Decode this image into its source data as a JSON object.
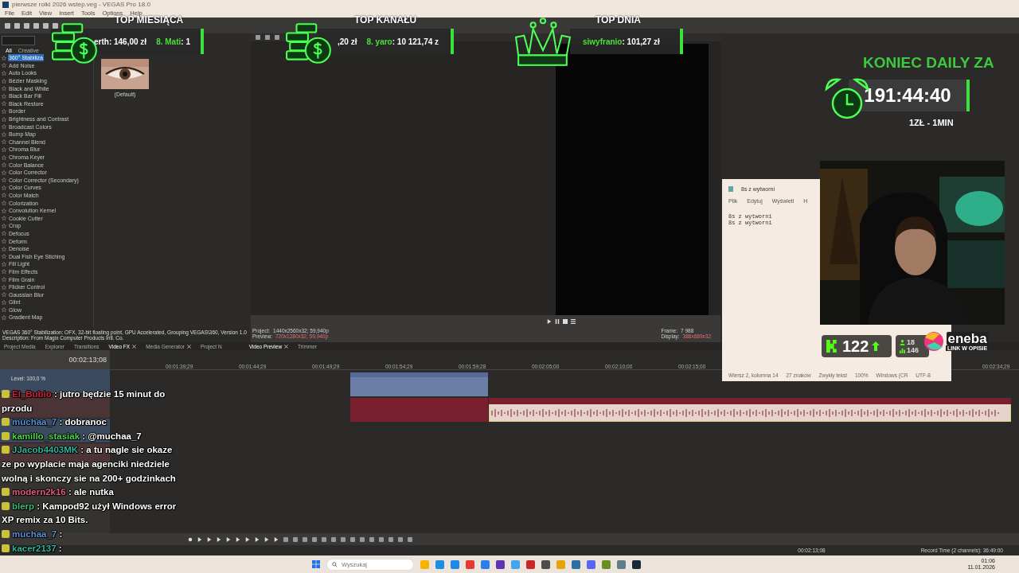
{
  "app": {
    "title": "pierwsze rolki 2026 wstep.veg - VEGAS Pro 18.0",
    "menu": [
      "File",
      "Edit",
      "View",
      "Insert",
      "Tools",
      "Options",
      "Help"
    ]
  },
  "fx_panel": {
    "filters": [
      {
        "label": "All",
        "selected": true
      },
      {
        "label": "Creative",
        "selected": false
      }
    ],
    "items": [
      {
        "label": "360° Stabiliza",
        "selected": true
      },
      {
        "label": "Add Noise",
        "selected": false
      },
      {
        "label": "Auto Looks",
        "selected": false
      },
      {
        "label": "Bézier Masking",
        "selected": false
      },
      {
        "label": "Black and White",
        "selected": false
      },
      {
        "label": "Black Bar Fill",
        "selected": false
      },
      {
        "label": "Black Restore",
        "selected": false
      },
      {
        "label": "Border",
        "selected": false
      },
      {
        "label": "Brightness and Contrast",
        "selected": false
      },
      {
        "label": "Broadcast Colors",
        "selected": false
      },
      {
        "label": "Bump Map",
        "selected": false
      },
      {
        "label": "Channel Blend",
        "selected": false
      },
      {
        "label": "Chroma Blur",
        "selected": false
      },
      {
        "label": "Chroma Keyer",
        "selected": false
      },
      {
        "label": "Color Balance",
        "selected": false
      },
      {
        "label": "Color Corrector",
        "selected": false
      },
      {
        "label": "Color Corrector (Secondary)",
        "selected": false
      },
      {
        "label": "Color Curves",
        "selected": false
      },
      {
        "label": "Color Match",
        "selected": false
      },
      {
        "label": "Colorization",
        "selected": false
      },
      {
        "label": "Convolution Kernel",
        "selected": false
      },
      {
        "label": "Cookie Cutter",
        "selected": false
      },
      {
        "label": "Crop",
        "selected": false
      },
      {
        "label": "Defocus",
        "selected": false
      },
      {
        "label": "Deform",
        "selected": false
      },
      {
        "label": "Denoise",
        "selected": false
      },
      {
        "label": "Dual Fish Eye Stiching",
        "selected": false
      },
      {
        "label": "Fill Light",
        "selected": false
      },
      {
        "label": "Film Effects",
        "selected": false
      },
      {
        "label": "Film Grain",
        "selected": false
      },
      {
        "label": "Flicker Control",
        "selected": false
      },
      {
        "label": "Gaussian Blur",
        "selected": false
      },
      {
        "label": "Glint",
        "selected": false
      },
      {
        "label": "Glow",
        "selected": false
      },
      {
        "label": "Gradient Map",
        "selected": false
      }
    ]
  },
  "presets": [
    {
      "label": "(Default)"
    }
  ],
  "description": [
    "VEGAS 360° Stabilization: OFX, 32-bit floating point, GPU Accelerated, Grouping VEGAS\\360, Version 1.0",
    "Description: From Magix Computer Products Intl. Co."
  ],
  "preview": {
    "info_left": [
      {
        "label": "Project:",
        "value": "1440x2560x32; 59,940p"
      },
      {
        "label": "Preview:",
        "value": "720x1280x32; 59,940p"
      }
    ],
    "info_right": [
      {
        "label": "Frame:",
        "value": "7 988"
      },
      {
        "label": "Display:",
        "value": "388x689x32"
      }
    ]
  },
  "dock_tabs": [
    {
      "label": "Project Media",
      "selected": false,
      "closable": false
    },
    {
      "label": "Explorer",
      "selected": false,
      "closable": false
    },
    {
      "label": "Transitions",
      "selected": false,
      "closable": false
    },
    {
      "label": "Video FX",
      "selected": true,
      "closable": true
    },
    {
      "label": "Media Generator",
      "selected": false,
      "closable": true
    },
    {
      "label": "Project N",
      "selected": false,
      "closable": false
    }
  ],
  "preview_tabs": [
    {
      "label": "Video Preview",
      "selected": true,
      "closable": true
    },
    {
      "label": "Trimmer",
      "selected": false,
      "closable": false
    }
  ],
  "timeline": {
    "time": "00:02:13;08",
    "level": "Level: 100,0 %",
    "ruler": [
      "00:01:39;29",
      "00:01:44;29",
      "00:01:49;29",
      "00:01:54;29",
      "00:01:59;28",
      "00:02:05;00",
      "00:02:10;00",
      "00:02:15;00",
      "00:02:34;29"
    ]
  },
  "status": {
    "cursor": "00:02:13;08",
    "record": "Record Time (2 channels): 36:49:00"
  },
  "taskbar": {
    "search": {
      "placeholder": "Wyszukaj"
    },
    "time": "01:06",
    "date": "11.01.2026"
  },
  "top_boards": [
    {
      "title": "TOP MIESIĄCA",
      "kind": "coins",
      "entries": [
        {
          "value": "erth: 146,00 zł"
        },
        {
          "name": "8. Mati",
          "value": ": 1"
        }
      ]
    },
    {
      "title": "TOP KANAŁU",
      "kind": "coins",
      "entries": [
        {
          "value": ",20 zł"
        },
        {
          "name": "8. yaro",
          "value": ": 10 121,74 z"
        }
      ]
    },
    {
      "title": "TOP DNIA",
      "kind": "crown",
      "entries": [
        {
          "name": "siwyfranio",
          "value": ": 101,27 zł"
        }
      ]
    }
  ],
  "timer": {
    "title": "KONIEC DAILY ZA",
    "time": "191:44:40",
    "rate": "1ZŁ - 1MIN"
  },
  "notepad": {
    "title": "8s z wytworni",
    "menu": [
      "Plik",
      "Edytuj",
      "Wyświetl",
      "H"
    ],
    "lines": [
      "8s z wytworni",
      "8s z wytworni"
    ],
    "status": [
      "Wiersz 2, kolumna 14",
      "27 znaków",
      "Zwykły tekst",
      "100%",
      "Windows (CR",
      "UTF-8"
    ]
  },
  "stats": {
    "followers": "122",
    "viewers": "18",
    "count": "146"
  },
  "sponsor": {
    "name": "eneba",
    "tagline": "LINK W OPISIE"
  },
  "chat": [
    {
      "user": "El_Bubio",
      "color": "#d0213b",
      "text": ": jutro będzie 15 minut do przodu"
    },
    {
      "user": "muchaa_7",
      "color": "#5b8fd6",
      "text": ": dobranoc"
    },
    {
      "user": "kamillo_stasiak",
      "color": "#4fd44a",
      "text": ": @muchaa_7"
    },
    {
      "user": "JJacob4403MK",
      "color": "#2fb59a",
      "text": ": a tu nagle sie okaze ze po wyplacie maja agenciki niedziele wolną i skonczy sie na 200+ godzinkach"
    },
    {
      "user": "modern2k16",
      "color": "#e05a7c",
      "text": ": ale nutka"
    },
    {
      "user": "blerp",
      "color": "#3fb87a",
      "text": ": Kampod92 użył Windows error XP remix za 10 Bits."
    },
    {
      "user": "muchaa_7",
      "color": "#5b8fd6",
      "text": ":"
    },
    {
      "user": "kacer2137",
      "color": "#2fb59a",
      "text": ":"
    }
  ]
}
